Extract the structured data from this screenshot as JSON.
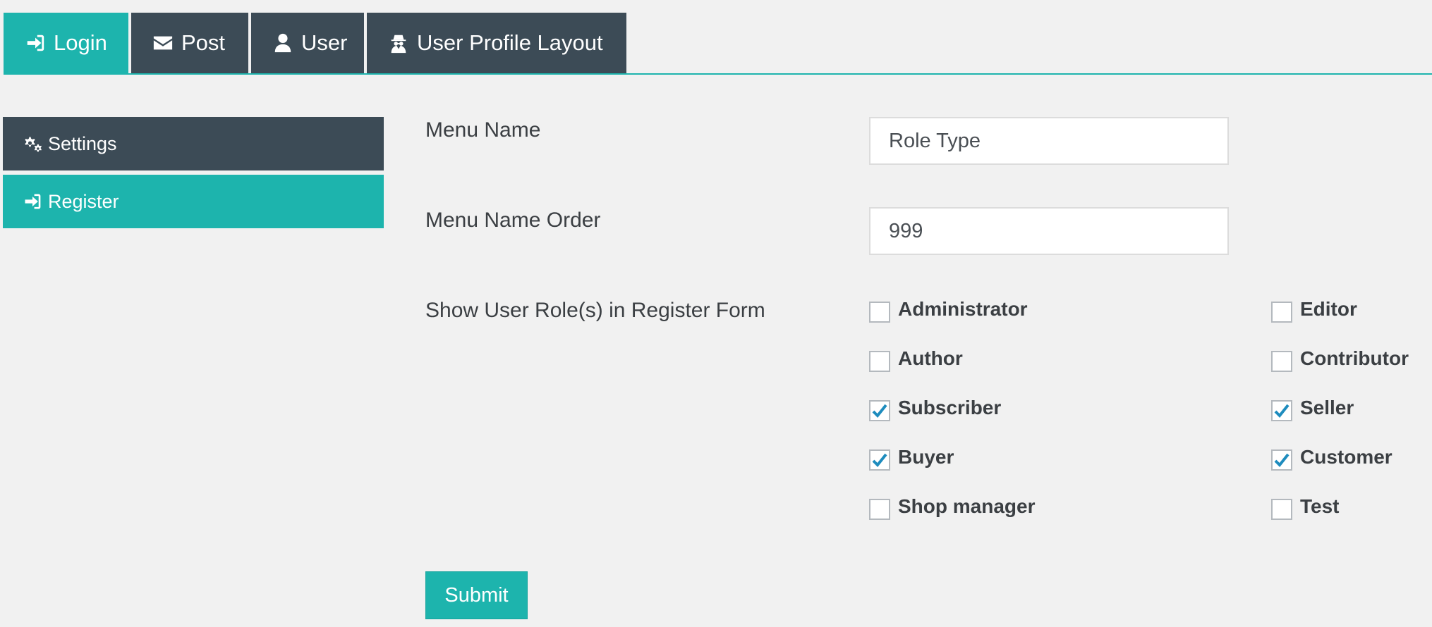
{
  "tabs": [
    {
      "label": "Login",
      "icon": "sign-in-icon",
      "active": true
    },
    {
      "label": "Post",
      "icon": "envelope-icon",
      "active": false
    },
    {
      "label": "User",
      "icon": "user-icon",
      "active": false
    },
    {
      "label": "User Profile Layout",
      "icon": "user-secret-icon",
      "active": false
    }
  ],
  "sidebar": {
    "items": [
      {
        "label": "Settings",
        "icon": "gears-icon",
        "active": false
      },
      {
        "label": "Register",
        "icon": "sign-in-icon",
        "active": true
      }
    ]
  },
  "form": {
    "menu_name": {
      "label": "Menu Name",
      "value": "Role Type"
    },
    "menu_order": {
      "label": "Menu Name Order",
      "value": "999"
    },
    "roles": {
      "label": "Show User Role(s) in Register Form",
      "items": [
        {
          "label": "Administrator",
          "checked": false
        },
        {
          "label": "Editor",
          "checked": false
        },
        {
          "label": "Author",
          "checked": false
        },
        {
          "label": "Contributor",
          "checked": false
        },
        {
          "label": "Subscriber",
          "checked": true
        },
        {
          "label": "Seller",
          "checked": true
        },
        {
          "label": "Buyer",
          "checked": true
        },
        {
          "label": "Customer",
          "checked": true
        },
        {
          "label": "Shop manager",
          "checked": false
        },
        {
          "label": "Test",
          "checked": false
        }
      ]
    },
    "submit_label": "Submit"
  },
  "colors": {
    "accent": "#1db4ad",
    "dark": "#3c4b56",
    "background": "#f1f1f1",
    "check": "#1e8cbe"
  }
}
